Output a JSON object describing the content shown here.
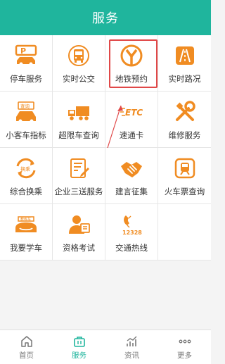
{
  "header": {
    "title": "服务"
  },
  "services": [
    {
      "label": "停车服务",
      "icon": "parking-icon"
    },
    {
      "label": "实时公交",
      "icon": "bus-icon"
    },
    {
      "label": "地铁预约",
      "icon": "metro-icon"
    },
    {
      "label": "实时路况",
      "icon": "traffic-road-icon"
    },
    {
      "label": "小客车指标",
      "icon": "car-icon",
      "icon_text": "查询"
    },
    {
      "label": "超限车查询",
      "icon": "truck-icon"
    },
    {
      "label": "速通卡",
      "icon": "etc-icon",
      "icon_text": "ETC"
    },
    {
      "label": "维修服务",
      "icon": "wrench-icon"
    },
    {
      "label": "综合换乘",
      "icon": "transfer-icon",
      "icon_text": "换乘"
    },
    {
      "label": "企业三送服务",
      "icon": "document-edit-icon"
    },
    {
      "label": "建言征集",
      "icon": "handshake-icon"
    },
    {
      "label": "火车票查询",
      "icon": "train-icon"
    },
    {
      "label": "我要学车",
      "icon": "learner-car-icon",
      "icon_text": "教练车"
    },
    {
      "label": "资格考试",
      "icon": "exam-icon"
    },
    {
      "label": "交通热线",
      "icon": "hotline-icon",
      "icon_text": "12328"
    }
  ],
  "tabs": [
    {
      "label": "首页",
      "icon": "home-icon",
      "active": false
    },
    {
      "label": "服务",
      "icon": "briefcase-icon",
      "active": true
    },
    {
      "label": "资讯",
      "icon": "chart-trend-icon",
      "active": false
    },
    {
      "label": "更多",
      "icon": "more-dots-icon",
      "active": false
    }
  ],
  "colors": {
    "brand": "#1fb59d",
    "icon_orange": "#f08c22",
    "highlight": "#e04848"
  }
}
